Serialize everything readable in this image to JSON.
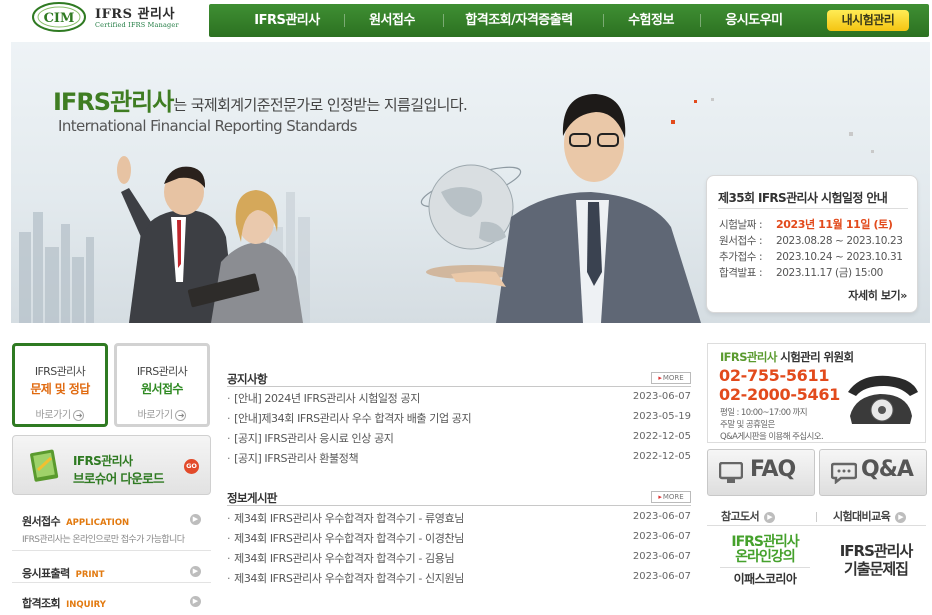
{
  "logo": {
    "title": "IFRS 관리사",
    "subtitle": "Certified IFRS Manager",
    "mark": "CIM"
  },
  "nav": {
    "items": [
      "IFRS관리사",
      "원서접수",
      "합격조회/자격증출력",
      "수험정보",
      "응시도우미"
    ],
    "my_exam": "내시험관리"
  },
  "hero": {
    "title_brand": "IFRS관리사",
    "title_rest": "는 국제회계기준전문가로 인정받는 지름길입니다.",
    "subtitle": "International Financial Reporting Standards"
  },
  "schedule": {
    "title": "제35회 IFRS관리사 시험일정 안내",
    "rows": [
      {
        "label": "시험날짜 :",
        "value": "2023년 11월 11일 (토)"
      },
      {
        "label": "원서접수 :",
        "value": "2023.08.28 ~ 2023.10.23"
      },
      {
        "label": "추가접수 :",
        "value": "2023.10.24 ~ 2023.10.31"
      },
      {
        "label": "합격발표 :",
        "value": "2023.11.17 (금) 15:00"
      }
    ],
    "more": "자세히 보기»"
  },
  "quick": [
    {
      "line1": "IFRS관리사",
      "line2": "문제 및 정답",
      "go": "바로가기"
    },
    {
      "line1": "IFRS관리사",
      "line2": "원서접수",
      "go": "바로가기"
    }
  ],
  "brochure": {
    "line1": "IFRS관리사",
    "line2": "브로슈어 다운로드",
    "go": "GO"
  },
  "left_menu": [
    {
      "ko": "원서접수",
      "en": "APPLICATION",
      "desc": "IFRS관리사는 온라인으로만 접수가 가능합니다"
    },
    {
      "ko": "응시표출력",
      "en": "PRINT",
      "desc": ""
    },
    {
      "ko": "합격조회",
      "en": "INQUIRY",
      "desc": ""
    }
  ],
  "notice": {
    "title": "공지사항",
    "more": "MORE",
    "posts": [
      {
        "title": "[안내] 2024년 IFRS관리사 시험일정 공지",
        "date": "2023-06-07"
      },
      {
        "title": "[안내]제34회 IFRS관리사 우수 합격자 배출 기업 공지",
        "date": "2023-05-19"
      },
      {
        "title": "[공지] IFRS관리사 응시료 인상 공지",
        "date": "2022-12-05"
      },
      {
        "title": "[공지] IFRS관리사 환불정책",
        "date": "2022-12-05"
      }
    ]
  },
  "info_board": {
    "title": "정보게시판",
    "more": "MORE",
    "posts": [
      {
        "title": "제34회 IFRS관리사 우수합격자 합격수기 - 류영효님",
        "date": "2023-06-07"
      },
      {
        "title": "제34회 IFRS관리사 우수합격자 합격수기 - 이경찬님",
        "date": "2023-06-07"
      },
      {
        "title": "제34회 IFRS관리사 우수합격자 합격수기 - 김용님",
        "date": "2023-06-07"
      },
      {
        "title": "제34회 IFRS관리사 우수합격자 합격수기 - 신지원님",
        "date": "2023-06-07"
      }
    ]
  },
  "contact": {
    "title_brand": "IFRS관리사",
    "title_rest": " 시험관리 위원회",
    "phone1": "02-755-5611",
    "phone2": "02-2000-5461",
    "hours": "평일 : 10:00~17:00 까지",
    "note1": "주말 및 공휴일은",
    "note2": "Q&A게시판을 이용해 주십시오."
  },
  "buttons": {
    "faq": "FAQ",
    "qa": "Q&A"
  },
  "right_tabs": {
    "ref_book": "참고도서",
    "prep": "시험대비교육"
  },
  "ads": {
    "online1": "IFRS관리사",
    "online2": "온라인강의",
    "online_brand": "이패스코리아",
    "book1": "IFRS관리사",
    "book2": "기출문제집"
  },
  "colors": {
    "brand_green": "#2f7a22",
    "accent_orange": "#e24a1c",
    "nav_yellow": "#f4c412"
  }
}
